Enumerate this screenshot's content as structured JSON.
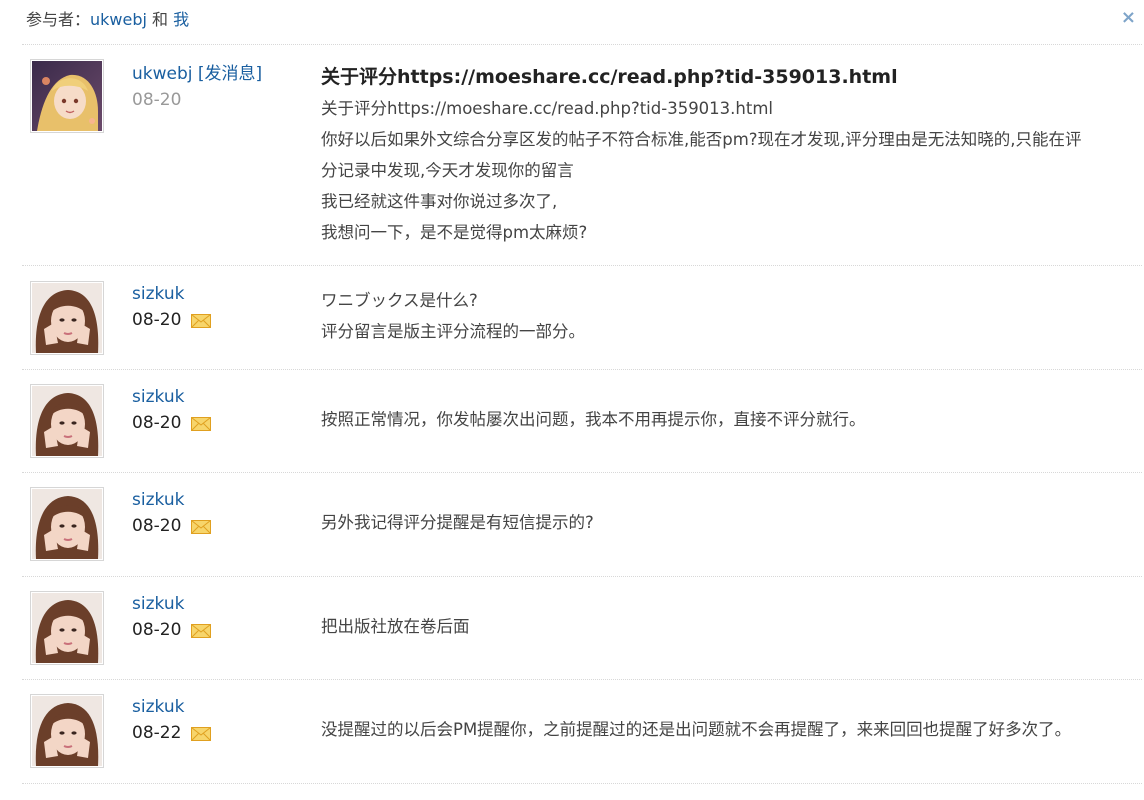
{
  "header": {
    "prefix": "参与者：",
    "participant1": "ukwebj",
    "and": " 和 ",
    "participant2": "我",
    "close": "×"
  },
  "messages": [
    {
      "user": "ukwebj",
      "send_msg": "[发消息]",
      "date": "08-20",
      "title": "关于评分https://moeshare.cc/read.php?tid-359013.html",
      "lines": [
        "关于评分https://moeshare.cc/read.php?tid-359013.html",
        "你好以后如果外文综合分享区发的帖子不符合标准,能否pm?现在才发现,评分理由是无法知晓的,只能在评",
        "分记录中发现,今天才发现你的留言",
        "我已经就这件事对你说过多次了,",
        "我想问一下，是不是觉得pm太麻烦?"
      ]
    },
    {
      "user": "sizkuk",
      "date": "08-20",
      "lines": [
        "ワニブックス是什么?",
        "评分留言是版主评分流程的一部分。"
      ]
    },
    {
      "user": "sizkuk",
      "date": "08-20",
      "lines": [
        "按照正常情况，你发帖屡次出问题，我本不用再提示你，直接不评分就行。"
      ]
    },
    {
      "user": "sizkuk",
      "date": "08-20",
      "lines": [
        "另外我记得评分提醒是有短信提示的?"
      ]
    },
    {
      "user": "sizkuk",
      "date": "08-20",
      "lines": [
        "把出版社放在卷后面"
      ]
    },
    {
      "user": "sizkuk",
      "date": "08-22",
      "lines": [
        "没提醒过的以后会PM提醒你，之前提醒过的还是出问题就不会再提醒了，来来回回也提醒了好多次了。"
      ]
    }
  ],
  "icons": {
    "mail": "envelope-icon",
    "close": "close-icon"
  },
  "colors": {
    "link": "#1a5fa0",
    "mail_fill": "#f7d56b",
    "mail_stroke": "#e0a020"
  }
}
